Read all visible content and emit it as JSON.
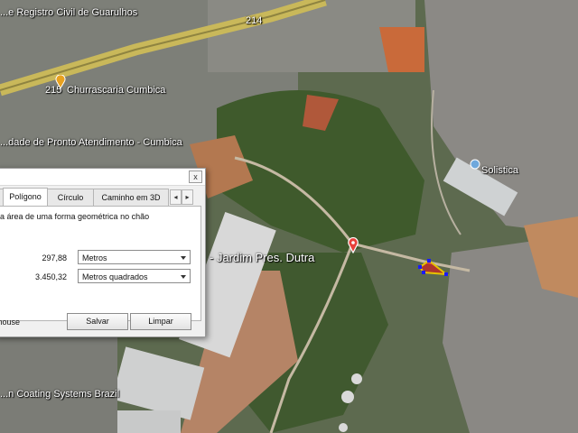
{
  "map": {
    "labels": {
      "registry": "...e Registro Civil de Guarulhos",
      "highway": "214",
      "highway2": "215",
      "churrascaria": "Churrascaria Cumbica",
      "upa": "...dade de Pronto Atendimento - Cumbica",
      "solistica": "Solistica",
      "jardim": "- Jardim Pres. Dutra",
      "coating": "...n Coating Systems Brazil"
    }
  },
  "dialog": {
    "close_label": "x",
    "tabs": [
      "Polígono",
      "Círculo",
      "Caminho em 3D"
    ],
    "active_tab": "Polígono",
    "tab_prev": "◂",
    "tab_next": "▸",
    "description": "a área de uma forma geométrica no chão",
    "perimeter_value": "297,88",
    "perimeter_unit": "Metros",
    "area_value": "3.450,32",
    "area_unit": "Metros quadrados",
    "mouse_label": "mouse",
    "save_label": "Salvar",
    "clear_label": "Limpar"
  },
  "colors": {
    "highway": "#c9b85a",
    "polygon_edge": "#e6c200",
    "polygon_fill": "#d32020",
    "vertex": "#1a1aff",
    "pin": "#e8413a"
  }
}
